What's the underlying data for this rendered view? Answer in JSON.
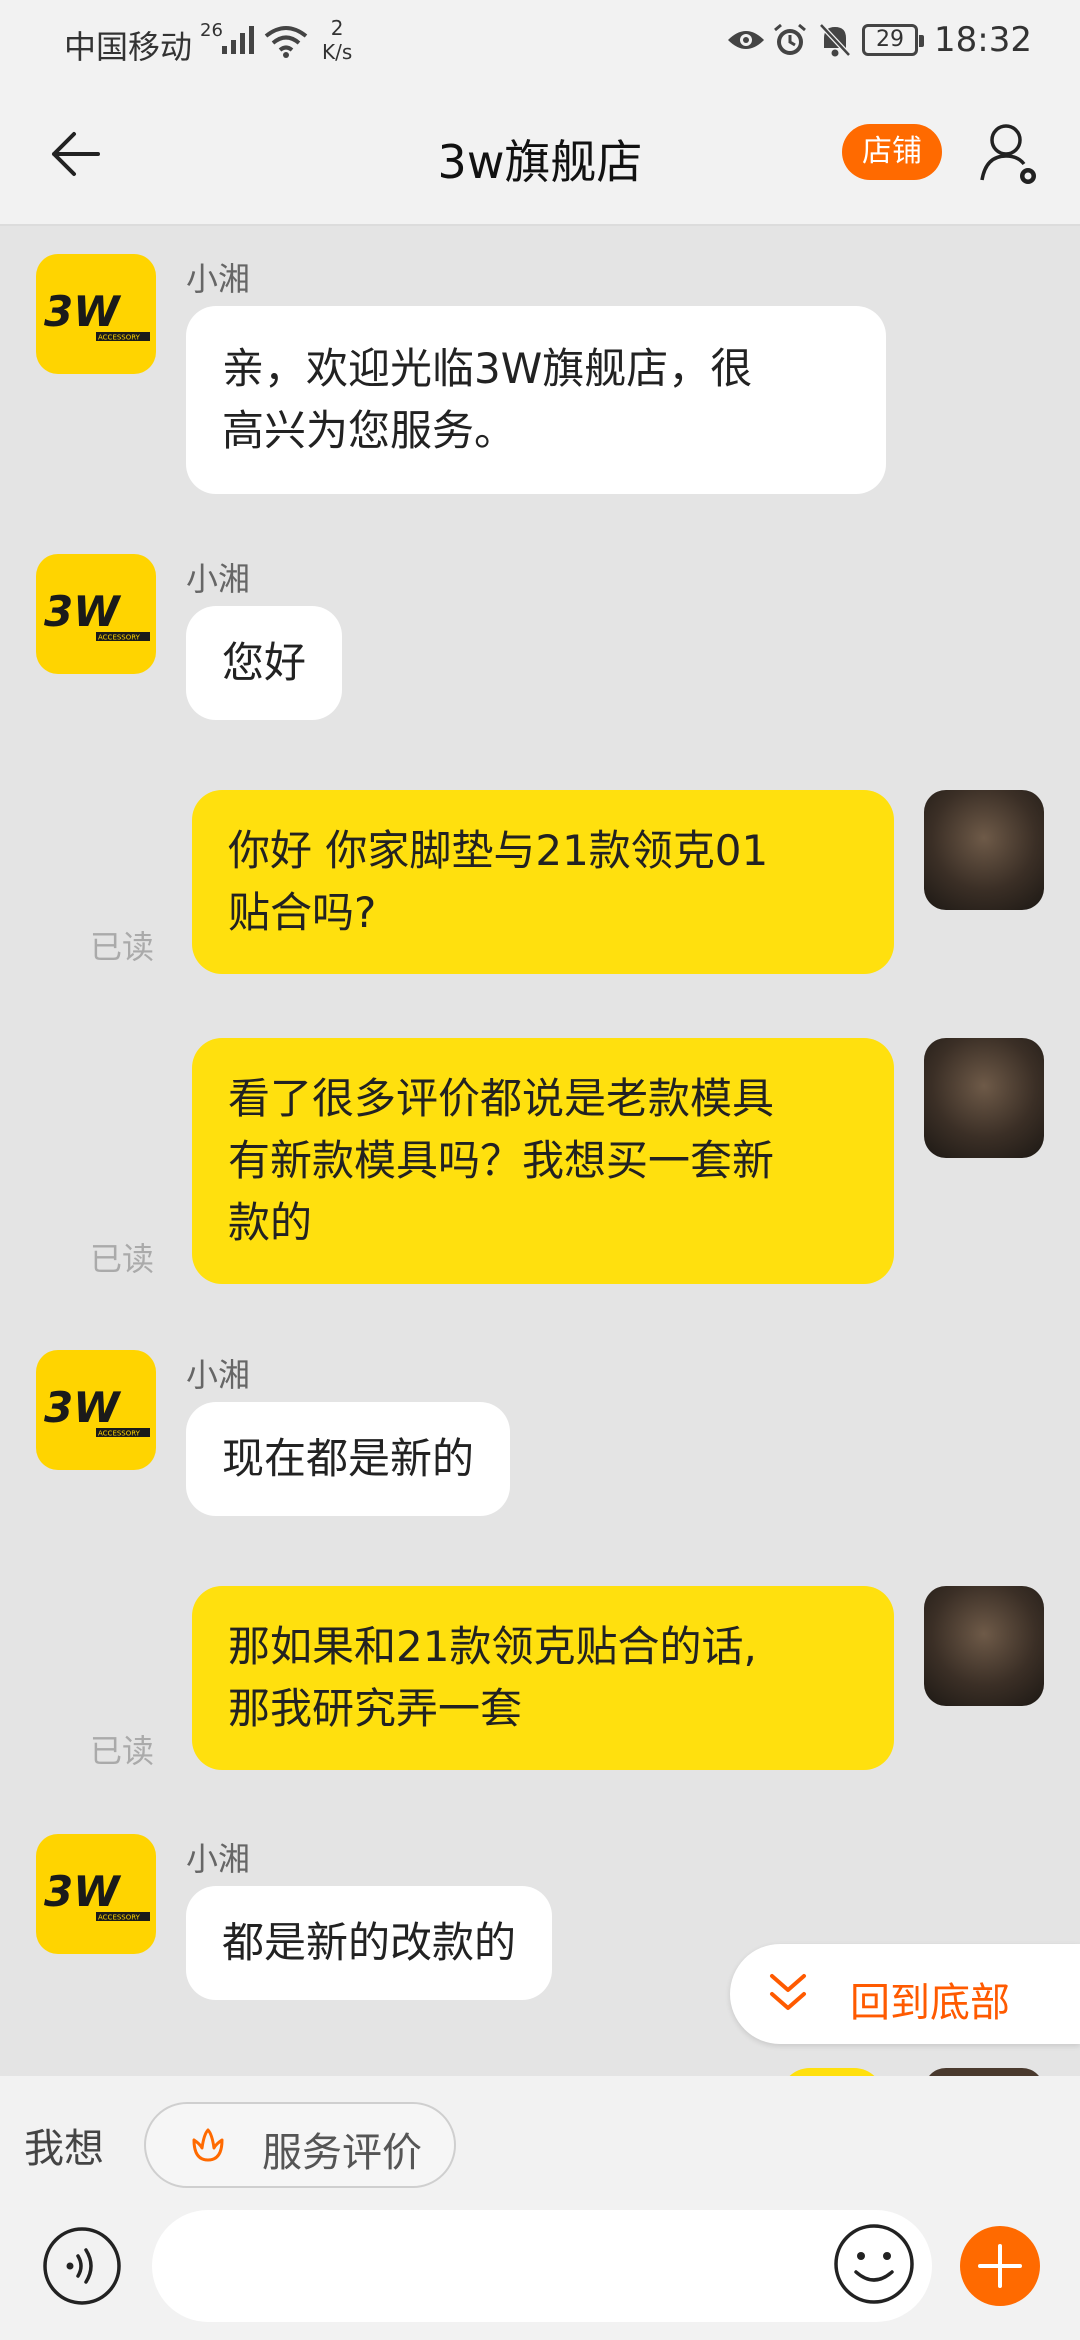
{
  "status_bar": {
    "carrier": "中国移动",
    "signal_label": "26",
    "speed_value": "2",
    "speed_unit": "K/s",
    "battery": "29",
    "time": "18:32"
  },
  "header": {
    "title": "3w旗舰店",
    "shop_button": "店铺"
  },
  "messages": [
    {
      "direction": "in",
      "sender": "小湘",
      "lines": [
        "亲，欢迎光临3W旗舰店，很",
        "高兴为您服务。"
      ]
    },
    {
      "direction": "in",
      "sender": "小湘",
      "lines": [
        "您好"
      ]
    },
    {
      "direction": "out",
      "status": "已读",
      "lines": [
        "你好 你家脚垫与21款领克01",
        "贴合吗?"
      ]
    },
    {
      "direction": "out",
      "status": "已读",
      "lines": [
        "看了很多评价都说是老款模具",
        "有新款模具吗？我想买一套新",
        "款的"
      ]
    },
    {
      "direction": "in",
      "sender": "小湘",
      "lines": [
        "现在都是新的"
      ]
    },
    {
      "direction": "out",
      "status": "已读",
      "lines": [
        "那如果和21款领克贴合的话,",
        "那我研究弄一套"
      ]
    },
    {
      "direction": "in",
      "sender": "小湘",
      "lines": [
        "都是新的改款的"
      ]
    }
  ],
  "shop_logo_text": "3W",
  "shop_logo_sub": "ACCESSORY",
  "scroll_to_bottom": "回到底部",
  "quick_bar": {
    "label": "我想",
    "rate_button": "服务评价"
  },
  "colors": {
    "accent": "#ff6a00",
    "outgoing_bubble": "#ffe00e",
    "incoming_bubble": "#ffffff",
    "chat_bg": "#e4e4e4"
  }
}
